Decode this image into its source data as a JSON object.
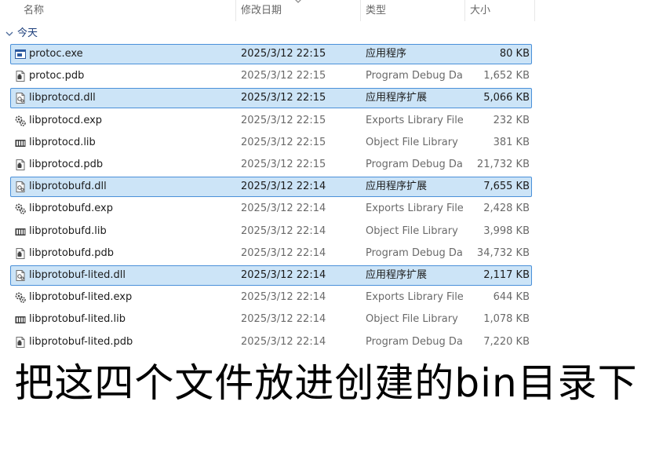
{
  "columns": {
    "name": "名称",
    "modified": "修改日期",
    "type": "类型",
    "size": "大小"
  },
  "group": {
    "label": "今天",
    "icon": "chevron-down-icon"
  },
  "files": [
    {
      "name": "protoc.exe",
      "date": "2025/3/12 22:15",
      "type": "应用程序",
      "size": "80 KB",
      "selected": true,
      "icon": "exe-icon"
    },
    {
      "name": "protoc.pdb",
      "date": "2025/3/12 22:15",
      "type": "Program Debug Da...",
      "size": "1,652 KB",
      "selected": false,
      "icon": "pdb-file-icon"
    },
    {
      "name": "libprotocd.dll",
      "date": "2025/3/12 22:15",
      "type": "应用程序扩展",
      "size": "5,066 KB",
      "selected": true,
      "icon": "dll-file-icon"
    },
    {
      "name": "libprotocd.exp",
      "date": "2025/3/12 22:15",
      "type": "Exports Library File",
      "size": "232 KB",
      "selected": false,
      "icon": "exp-file-icon"
    },
    {
      "name": "libprotocd.lib",
      "date": "2025/3/12 22:15",
      "type": "Object File Library",
      "size": "381 KB",
      "selected": false,
      "icon": "lib-file-icon"
    },
    {
      "name": "libprotocd.pdb",
      "date": "2025/3/12 22:15",
      "type": "Program Debug Da...",
      "size": "21,732 KB",
      "selected": false,
      "icon": "pdb-file-icon"
    },
    {
      "name": "libprotobufd.dll",
      "date": "2025/3/12 22:14",
      "type": "应用程序扩展",
      "size": "7,655 KB",
      "selected": true,
      "icon": "dll-file-icon"
    },
    {
      "name": "libprotobufd.exp",
      "date": "2025/3/12 22:14",
      "type": "Exports Library File",
      "size": "2,428 KB",
      "selected": false,
      "icon": "exp-file-icon"
    },
    {
      "name": "libprotobufd.lib",
      "date": "2025/3/12 22:14",
      "type": "Object File Library",
      "size": "3,998 KB",
      "selected": false,
      "icon": "lib-file-icon"
    },
    {
      "name": "libprotobufd.pdb",
      "date": "2025/3/12 22:14",
      "type": "Program Debug Da...",
      "size": "34,732 KB",
      "selected": false,
      "icon": "pdb-file-icon"
    },
    {
      "name": "libprotobuf-lited.dll",
      "date": "2025/3/12 22:14",
      "type": "应用程序扩展",
      "size": "2,117 KB",
      "selected": true,
      "icon": "dll-file-icon"
    },
    {
      "name": "libprotobuf-lited.exp",
      "date": "2025/3/12 22:14",
      "type": "Exports Library File",
      "size": "644 KB",
      "selected": false,
      "icon": "exp-file-icon"
    },
    {
      "name": "libprotobuf-lited.lib",
      "date": "2025/3/12 22:14",
      "type": "Object File Library",
      "size": "1,078 KB",
      "selected": false,
      "icon": "lib-file-icon"
    },
    {
      "name": "libprotobuf-lited.pdb",
      "date": "2025/3/12 22:14",
      "type": "Program Debug Da...",
      "size": "7,220 KB",
      "selected": false,
      "icon": "pdb-file-icon"
    }
  ],
  "caption": "把这四个文件放进创建的bin目录下",
  "colors": {
    "selection_fill": "#cce4f7",
    "selection_border": "#4a90d9",
    "header_text": "#666666",
    "group_text": "#1b3d7a"
  }
}
